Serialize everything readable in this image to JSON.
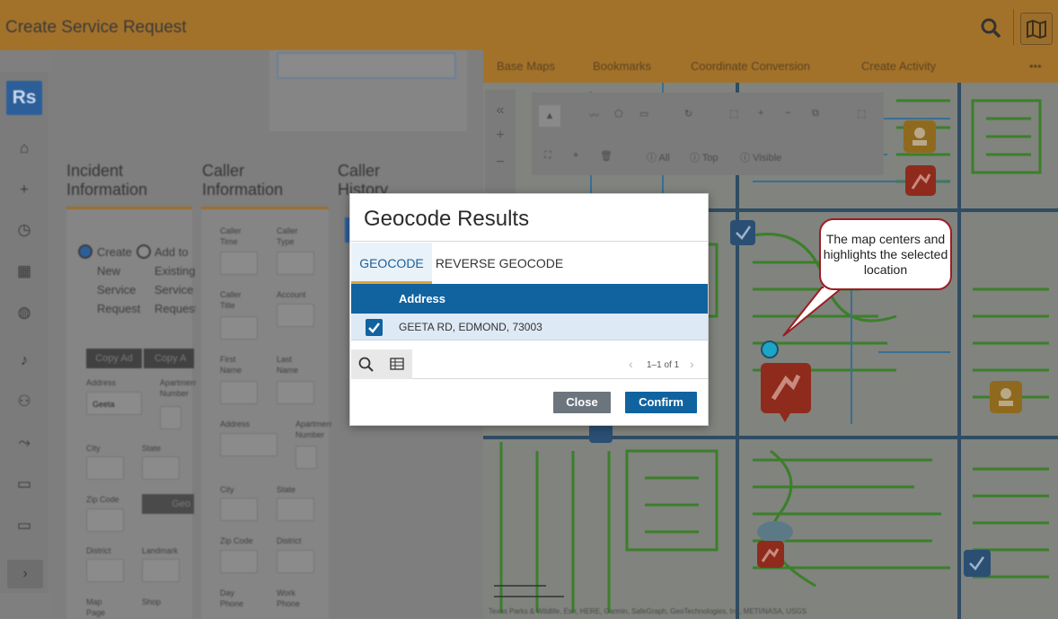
{
  "header": {
    "title": "Create Service Request"
  },
  "sidebar": {
    "logo": "Rs"
  },
  "form": {
    "sections": [
      "Incident Information",
      "Caller Information",
      "Caller History"
    ],
    "radio_create": "Create New Service Request",
    "radio_add": "Add to Existing Service Request",
    "copy_address": "Copy Ad",
    "copy_address2": "Copy A",
    "address_label": "Address",
    "address_value": "Geeta",
    "apartment_label": "Apartment Number",
    "city_label": "City",
    "state_label": "State",
    "zip_label": "Zip Code",
    "geocode_btn": "Geo",
    "district_label": "District",
    "landmark_label": "Landmark",
    "map_page_label": "Map Page",
    "shop_label": "Shop",
    "caller_time": "Caller Time",
    "caller_type": "Caller Type",
    "caller_title": "Caller Title",
    "account": "Account",
    "first_name": "First Name",
    "last_name": "Last Name",
    "caller_address": "Address",
    "caller_apartment": "Apartment Number",
    "caller_city": "City",
    "caller_state": "State",
    "caller_zip": "Zip Code",
    "caller_district": "District",
    "day_phone": "Day Phone",
    "work_phone": "Work Phone"
  },
  "map": {
    "toolbar": [
      "Base Maps",
      "Bookmarks",
      "Coordinate Conversion",
      "Create Activity"
    ],
    "controls": [
      "All",
      "Top",
      "Visible"
    ],
    "attribution": "Texas Parks & Wildlife, Esri, HERE, Garmin, SafeGraph, GeoTechnologies, Inc, METI/NASA, USGS"
  },
  "dialog": {
    "title": "Geocode Results",
    "tabs": [
      "GEOCODE",
      "REVERSE GEOCODE"
    ],
    "column_header": "Address",
    "rows": [
      {
        "address": "GEETA RD, EDMOND, 73003",
        "checked": true
      }
    ],
    "pager_text": "1–1 of 1",
    "close_label": "Close",
    "confirm_label": "Confirm"
  },
  "callout": {
    "text": "The map centers and highlights the selected location"
  },
  "colors": {
    "accent": "#11639f",
    "header_bg": "#a3722a",
    "callout_border": "#9c1d24",
    "tab_underline": "#e1a538"
  }
}
